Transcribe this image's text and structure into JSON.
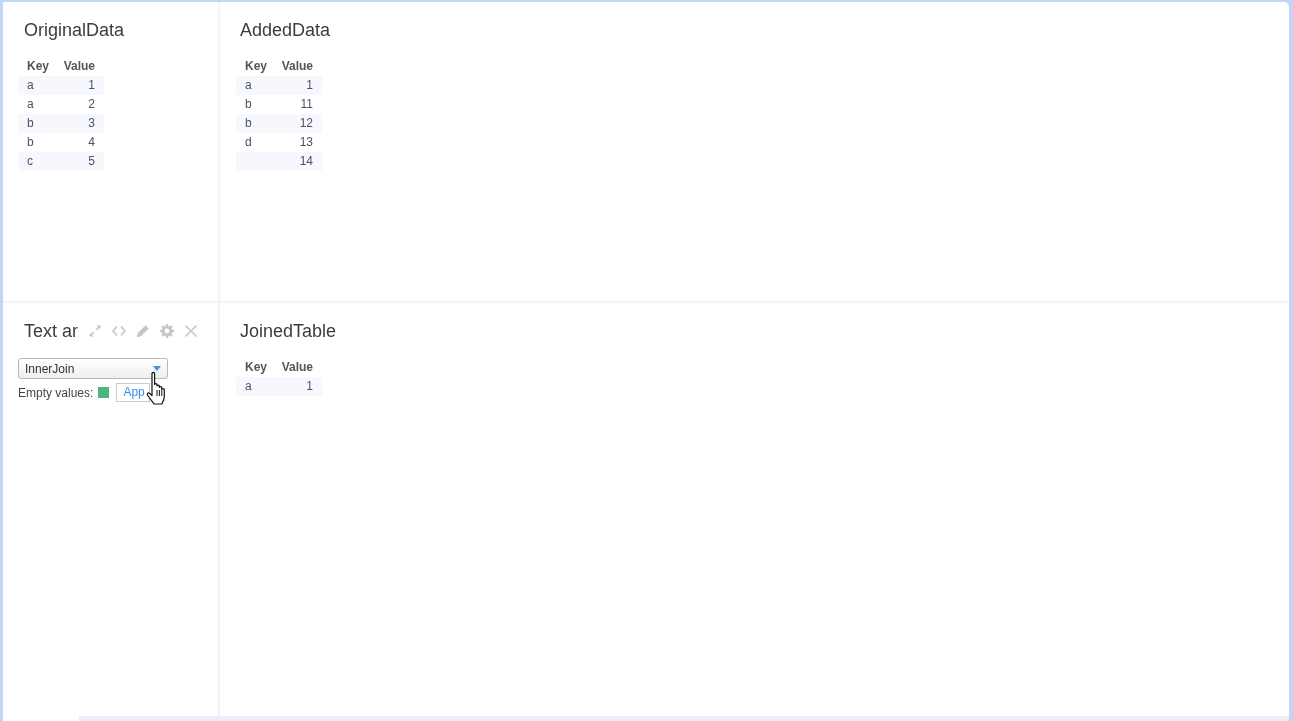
{
  "panels": [
    {
      "kind": "table",
      "title": "OriginalData",
      "table": {
        "columns": [
          "Key",
          "Value"
        ],
        "rows": [
          {
            "key": "a",
            "value": "1"
          },
          {
            "key": "a",
            "value": "2"
          },
          {
            "key": "b",
            "value": "3"
          },
          {
            "key": "b",
            "value": "4"
          },
          {
            "key": "c",
            "value": "5"
          }
        ]
      }
    },
    {
      "kind": "table",
      "title": "AddedData",
      "table": {
        "columns": [
          "Key",
          "Value"
        ],
        "rows": [
          {
            "key": "a",
            "value": "1"
          },
          {
            "key": "b",
            "value": "11"
          },
          {
            "key": "b",
            "value": "12"
          },
          {
            "key": "d",
            "value": "13"
          },
          {
            "value": "14"
          }
        ]
      }
    },
    {
      "kind": "controls",
      "title": "Text ar",
      "join_select": {
        "value": "InnerJoin"
      },
      "empty_values": {
        "label": "Empty values:"
      },
      "apply_button": {
        "label": "App"
      }
    },
    {
      "kind": "table",
      "title": "JoinedTable",
      "table": {
        "columns": [
          "Key",
          "Value"
        ],
        "rows": [
          {
            "key": "a",
            "value": "1"
          }
        ]
      }
    }
  ]
}
